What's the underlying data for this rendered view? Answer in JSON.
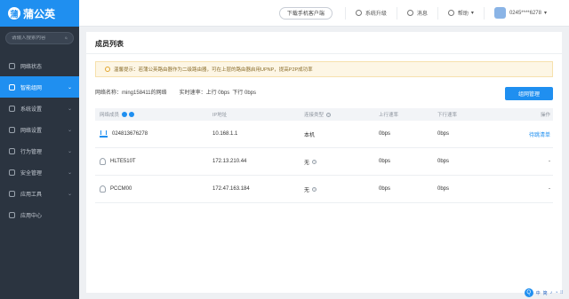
{
  "app": {
    "logo_text": "蒲公英",
    "logo_mark": "蒲"
  },
  "sidebar": {
    "search_placeholder": "请输入搜索内容",
    "items": [
      {
        "label": "网络状态",
        "chev": ""
      },
      {
        "label": "智能组网",
        "chev": "⌄"
      },
      {
        "label": "系统设置",
        "chev": "⌄"
      },
      {
        "label": "网络设置",
        "chev": "⌄"
      },
      {
        "label": "行为管理",
        "chev": "⌄"
      },
      {
        "label": "安全管理",
        "chev": "⌄"
      },
      {
        "label": "应用工具",
        "chev": "⌄"
      },
      {
        "label": "应用中心",
        "chev": ""
      }
    ]
  },
  "topbar": {
    "download_label": "下载手机客户端",
    "upgrade_label": "系统升级",
    "message_label": "消息",
    "help_label": "帮助",
    "help_chev": "▾",
    "account": "0245****6278",
    "account_chev": "▾"
  },
  "page": {
    "title": "成员列表",
    "notice": "温馨提示：若蒲公英路由器作为二级路由器，可在上层的路由器启用UPNP，提高P2P成功率",
    "network_name_label": "网络名称：",
    "network_name": "ming158411的网络",
    "rate_label": "实时速率：",
    "up_rate": "上行 0bps",
    "down_rate": "下行 0bps",
    "group_button": "组网管理"
  },
  "table": {
    "headers": [
      "网络成员",
      "IP地址",
      "连接类型",
      "上行速率",
      "下行速率",
      "操作"
    ],
    "rows": [
      {
        "name": "024813676278",
        "ip": "10.168.1.1",
        "type": "本机",
        "up": "0bps",
        "down": "0bps",
        "action": "待跳清单",
        "icon": "router-icon"
      },
      {
        "name": "HLTE510T",
        "ip": "172.13.210.44",
        "type": "无",
        "up": "0bps",
        "down": "0bps",
        "action": "-",
        "icon": "user-icon"
      },
      {
        "name": "PCCM00",
        "ip": "172.47.163.184",
        "type": "无",
        "up": "0bps",
        "down": "0bps",
        "action": "-",
        "icon": "user-icon"
      }
    ],
    "help_glyph": "?"
  },
  "ime": {
    "q": "Q",
    "items": [
      "中",
      "简",
      "♪",
      "◔",
      "⁞⁞"
    ]
  },
  "colors": {
    "accent": "#1f8ff0",
    "sidebar_bg": "#2b3440",
    "notice_bg": "#fdf6e5"
  }
}
